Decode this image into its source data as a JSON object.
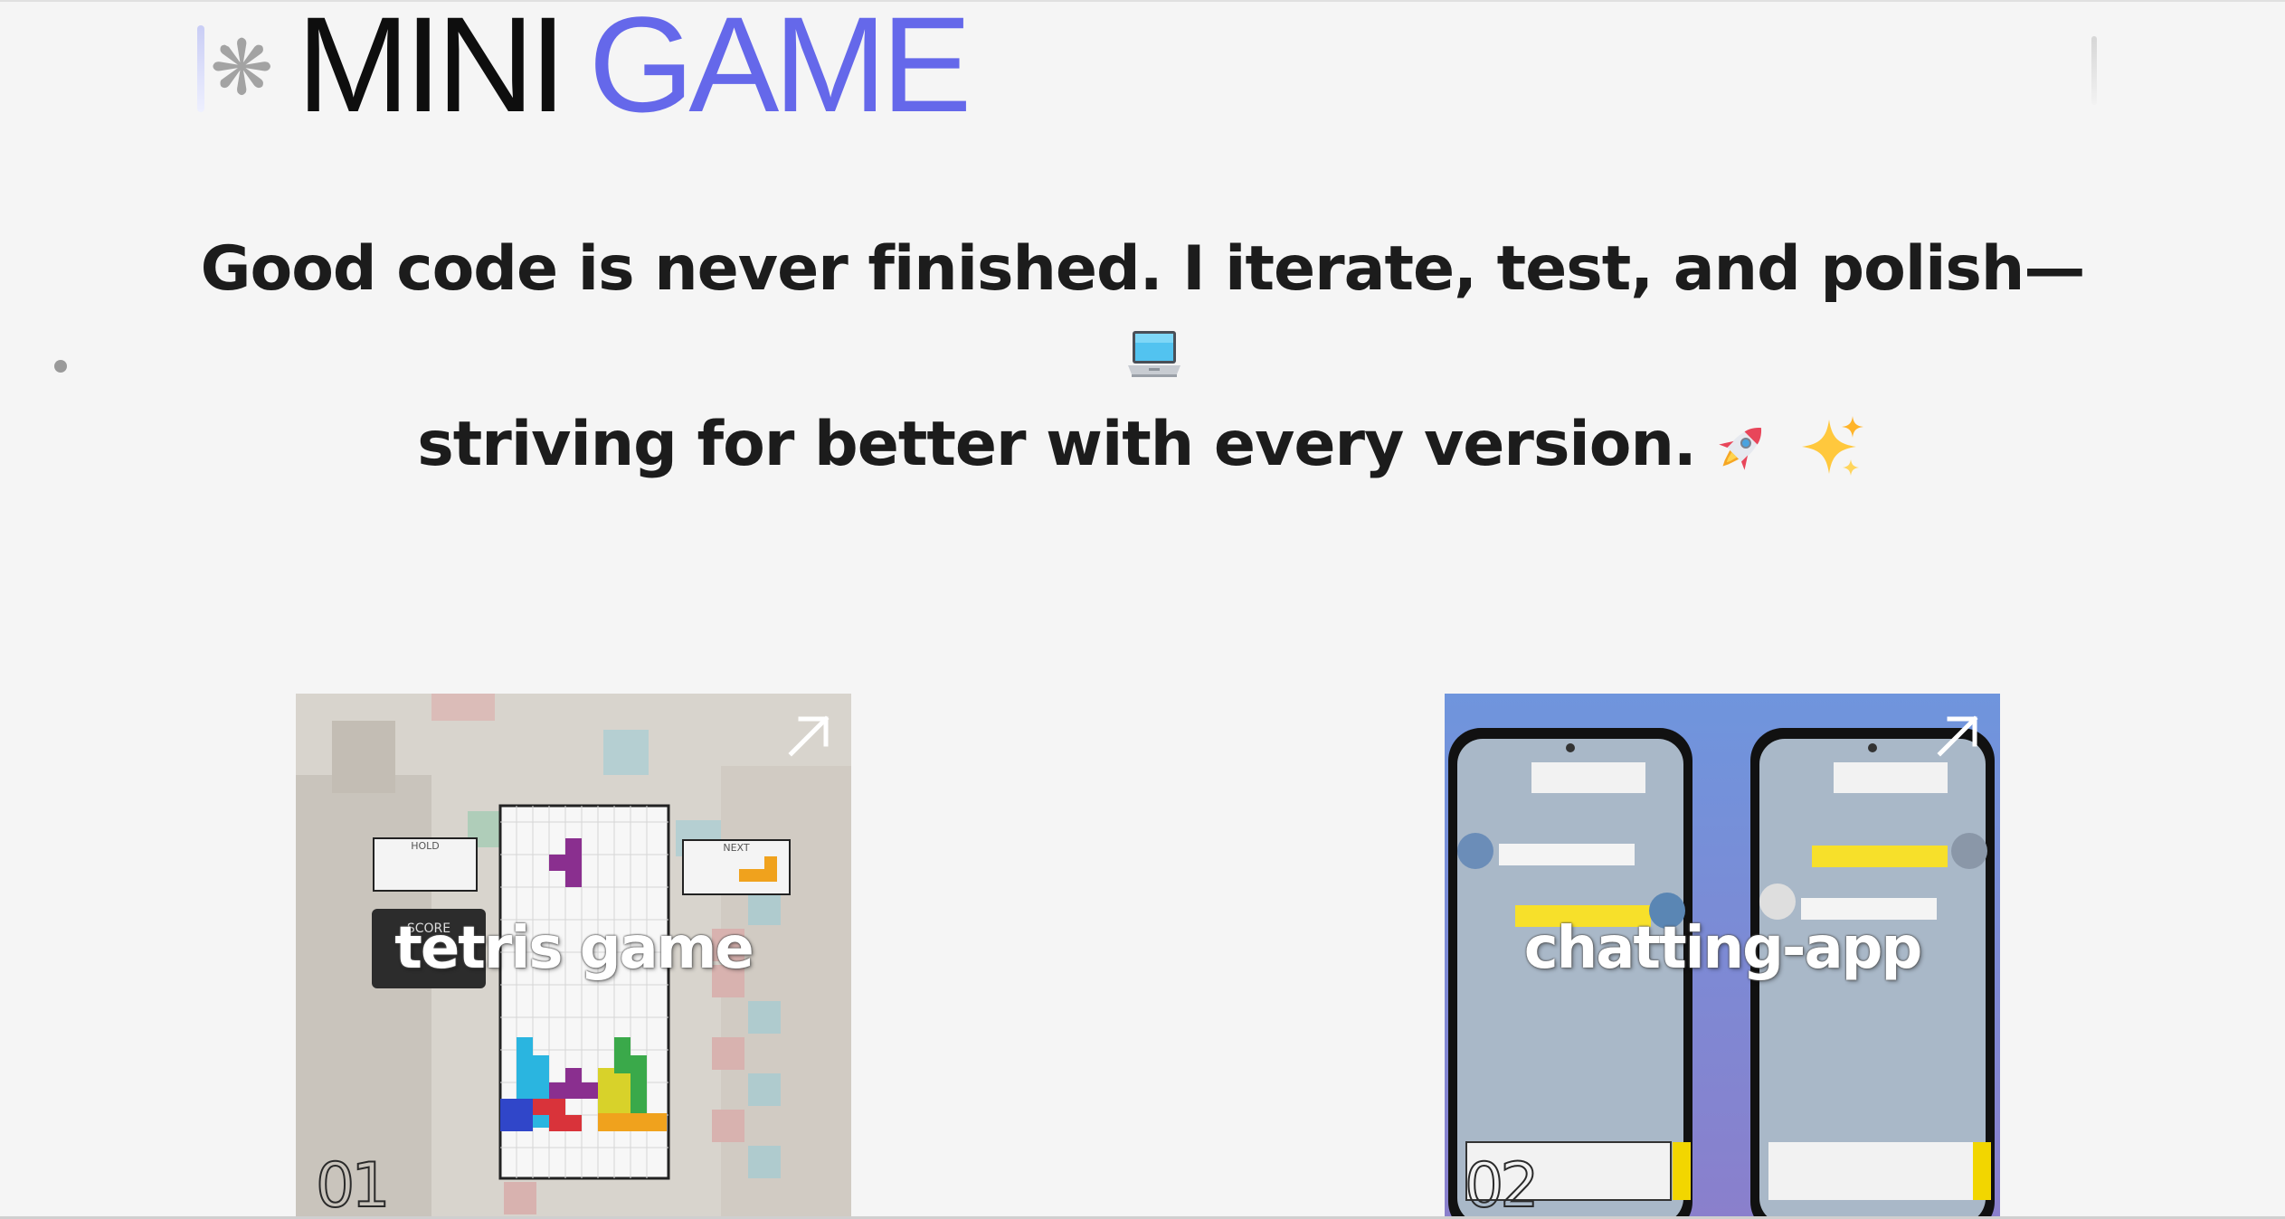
{
  "header": {
    "title_part1": "MINI",
    "title_part2": "GAME",
    "accent_color": "#6568ea",
    "decor_icon": "asterisk-icon"
  },
  "quote": {
    "line1": "Good code is never finished. I iterate, test, and polish—",
    "line2_emoji": "laptop-icon",
    "line3": "striving for better with every version.",
    "line3_emojis": [
      "rocket-icon",
      "sparkles-icon"
    ]
  },
  "projects": [
    {
      "number": "01",
      "label": "tetris game",
      "thumbnail": "tetris-screenshot",
      "link_icon": "arrow-up-right-icon"
    },
    {
      "number": "02",
      "label": "chatting-app",
      "thumbnail": "chat-app-screenshot",
      "link_icon": "arrow-up-right-icon"
    }
  ]
}
